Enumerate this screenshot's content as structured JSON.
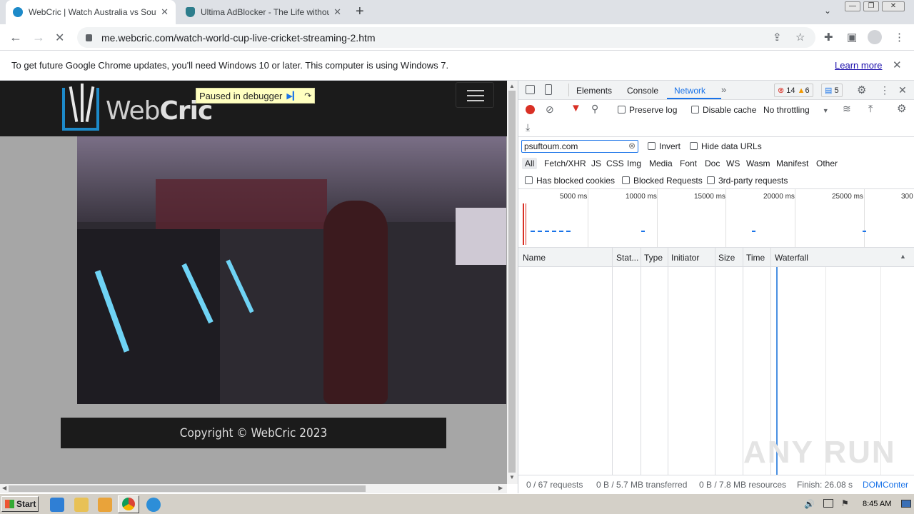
{
  "tabs": [
    {
      "title": "WebCric | Watch Australia vs South",
      "close": "✕",
      "active": true
    },
    {
      "title": "Ultima AdBlocker - The Life without A",
      "close": "✕",
      "active": false
    }
  ],
  "new_tab": "+",
  "address": {
    "url": "me.webcric.com/watch-world-cup-live-cricket-streaming-2.htm"
  },
  "infobar": {
    "message": "To get future Google Chrome updates, you'll need Windows 10 or later. This computer is using Windows 7.",
    "learn_more": "Learn more",
    "close": "✕"
  },
  "site": {
    "logo_text_a": "Web",
    "logo_text_b": "Cric",
    "paused_label": "Paused in debugger",
    "copyright": "Copyright © WebCric 2023"
  },
  "devtools": {
    "tabs": [
      "Elements",
      "Console",
      "Network"
    ],
    "more": "»",
    "active_tab": "Network",
    "errors": "14",
    "warnings": "6",
    "messages": "5",
    "preserve_log": "Preserve log",
    "disable_cache": "Disable cache",
    "throttling": "No throttling",
    "filter_value": "psuftoum.com",
    "invert": "Invert",
    "hide_data_urls": "Hide data URLs",
    "type_filters": [
      "All",
      "Fetch/XHR",
      "JS",
      "CSS",
      "Img",
      "Media",
      "Font",
      "Doc",
      "WS",
      "Wasm",
      "Manifest",
      "Other"
    ],
    "has_blocked_cookies": "Has blocked cookies",
    "blocked_requests": "Blocked Requests",
    "third_party": "3rd-party requests",
    "timeline_ticks": [
      "5000 ms",
      "10000 ms",
      "15000 ms",
      "20000 ms",
      "25000 ms",
      "300"
    ],
    "columns": [
      "Name",
      "Stat...",
      "Type",
      "Initiator",
      "Size",
      "Time",
      "Waterfall"
    ],
    "status": {
      "requests": "0 / 67 requests",
      "transferred": "0 B / 5.7 MB transferred",
      "resources": "0 B / 7.8 MB resources",
      "finish": "Finish: 26.08 s",
      "dom": "DOMConter"
    }
  },
  "taskbar": {
    "start": "Start",
    "clock": "8:45 AM"
  },
  "watermark": "ANY RUN",
  "colors": {
    "accent_blue": "#1a73e8",
    "record_red": "#d93025",
    "site_dark": "#1b1b1b",
    "logo_blue": "#1d8ac9",
    "paused_bg": "#ffffc0"
  }
}
